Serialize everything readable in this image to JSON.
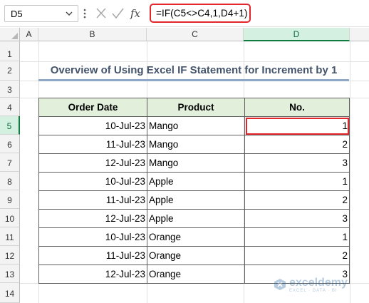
{
  "formula_bar": {
    "name_box": "D5",
    "formula": "=IF(C5<>C4,1,D4+1)"
  },
  "columns": [
    "A",
    "B",
    "C",
    "D"
  ],
  "selected_column": "D",
  "rows": [
    "1",
    "2",
    "3",
    "4",
    "5",
    "6",
    "7",
    "8",
    "9",
    "10",
    "11",
    "12",
    "13",
    "14"
  ],
  "selected_row": "5",
  "sheet": {
    "title": "Overview of Using Excel IF Statement for Increment by 1",
    "headers": {
      "date": "Order Date",
      "product": "Product",
      "no": "No."
    },
    "records": [
      {
        "date": "10-Jul-23",
        "product": "Mango",
        "no": "1"
      },
      {
        "date": "11-Jul-23",
        "product": "Mango",
        "no": "2"
      },
      {
        "date": "12-Jul-23",
        "product": "Mango",
        "no": "3"
      },
      {
        "date": "10-Jul-23",
        "product": "Apple",
        "no": "1"
      },
      {
        "date": "11-Jul-23",
        "product": "Apple",
        "no": "2"
      },
      {
        "date": "12-Jul-23",
        "product": "Apple",
        "no": "3"
      },
      {
        "date": "10-Jul-23",
        "product": "Orange",
        "no": "1"
      },
      {
        "date": "11-Jul-23",
        "product": "Orange",
        "no": "2"
      },
      {
        "date": "12-Jul-23",
        "product": "Orange",
        "no": "3"
      }
    ]
  },
  "watermark": {
    "name": "exceldemy",
    "tagline": "EXCEL · DATA · BI"
  },
  "colors": {
    "highlight_border": "#e3262c",
    "header_fill": "#e2efda",
    "selection_green": "#107c41",
    "title_text": "#44546a"
  },
  "icons": [
    "chevron-down-icon",
    "more-vertical-icon",
    "cancel-icon",
    "enter-icon",
    "function-icon",
    "exceldemy-logo-icon"
  ]
}
